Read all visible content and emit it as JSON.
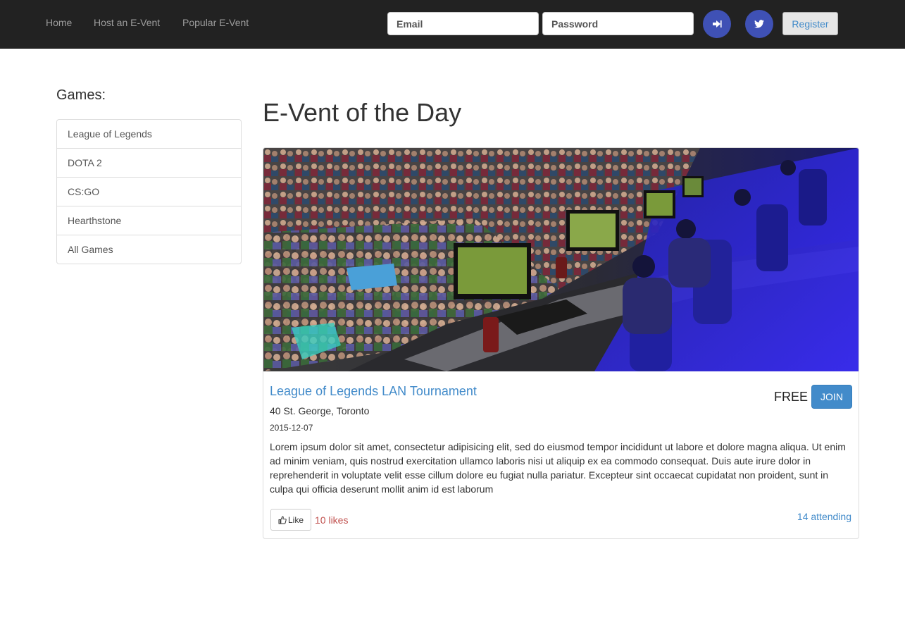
{
  "nav": {
    "links": [
      "Home",
      "Host an E-Vent",
      "Popular E-Vent"
    ],
    "email_placeholder": "Email",
    "password_placeholder": "Password",
    "login_icon": "sign-in-icon",
    "twitter_icon": "twitter-icon",
    "register_label": "Register"
  },
  "sidebar": {
    "heading": "Games:",
    "items": [
      "League of Legends",
      "DOTA 2",
      "CS:GO",
      "Hearthstone",
      "All Games"
    ]
  },
  "main": {
    "heading": "E-Vent of the Day",
    "event": {
      "image": "esports-lan-arena-photo",
      "title": "League of Legends LAN Tournament",
      "location": "40 St. George, Toronto",
      "date": "2015-12-07",
      "price": "FREE",
      "join_label": "JOIN",
      "description": "Lorem ipsum dolor sit amet, consectetur adipisicing elit, sed do eiusmod tempor incididunt ut labore et dolore magna aliqua. Ut enim ad minim veniam, quis nostrud exercitation ullamco laboris nisi ut aliquip ex ea commodo consequat. Duis aute irure dolor in reprehenderit in voluptate velit esse cillum dolore eu fugiat nulla pariatur. Excepteur sint occaecat cupidatat non proident, sunt in culpa qui officia deserunt mollit anim id est laborum",
      "like_label": "Like",
      "like_icon": "thumbs-up-icon",
      "likes_text": "10 likes",
      "attending_text": "14 attending"
    }
  },
  "colors": {
    "navbar_bg": "#222222",
    "circle_button": "#3f51b5",
    "link_blue": "#428bca",
    "likes_red": "#c0504d"
  }
}
